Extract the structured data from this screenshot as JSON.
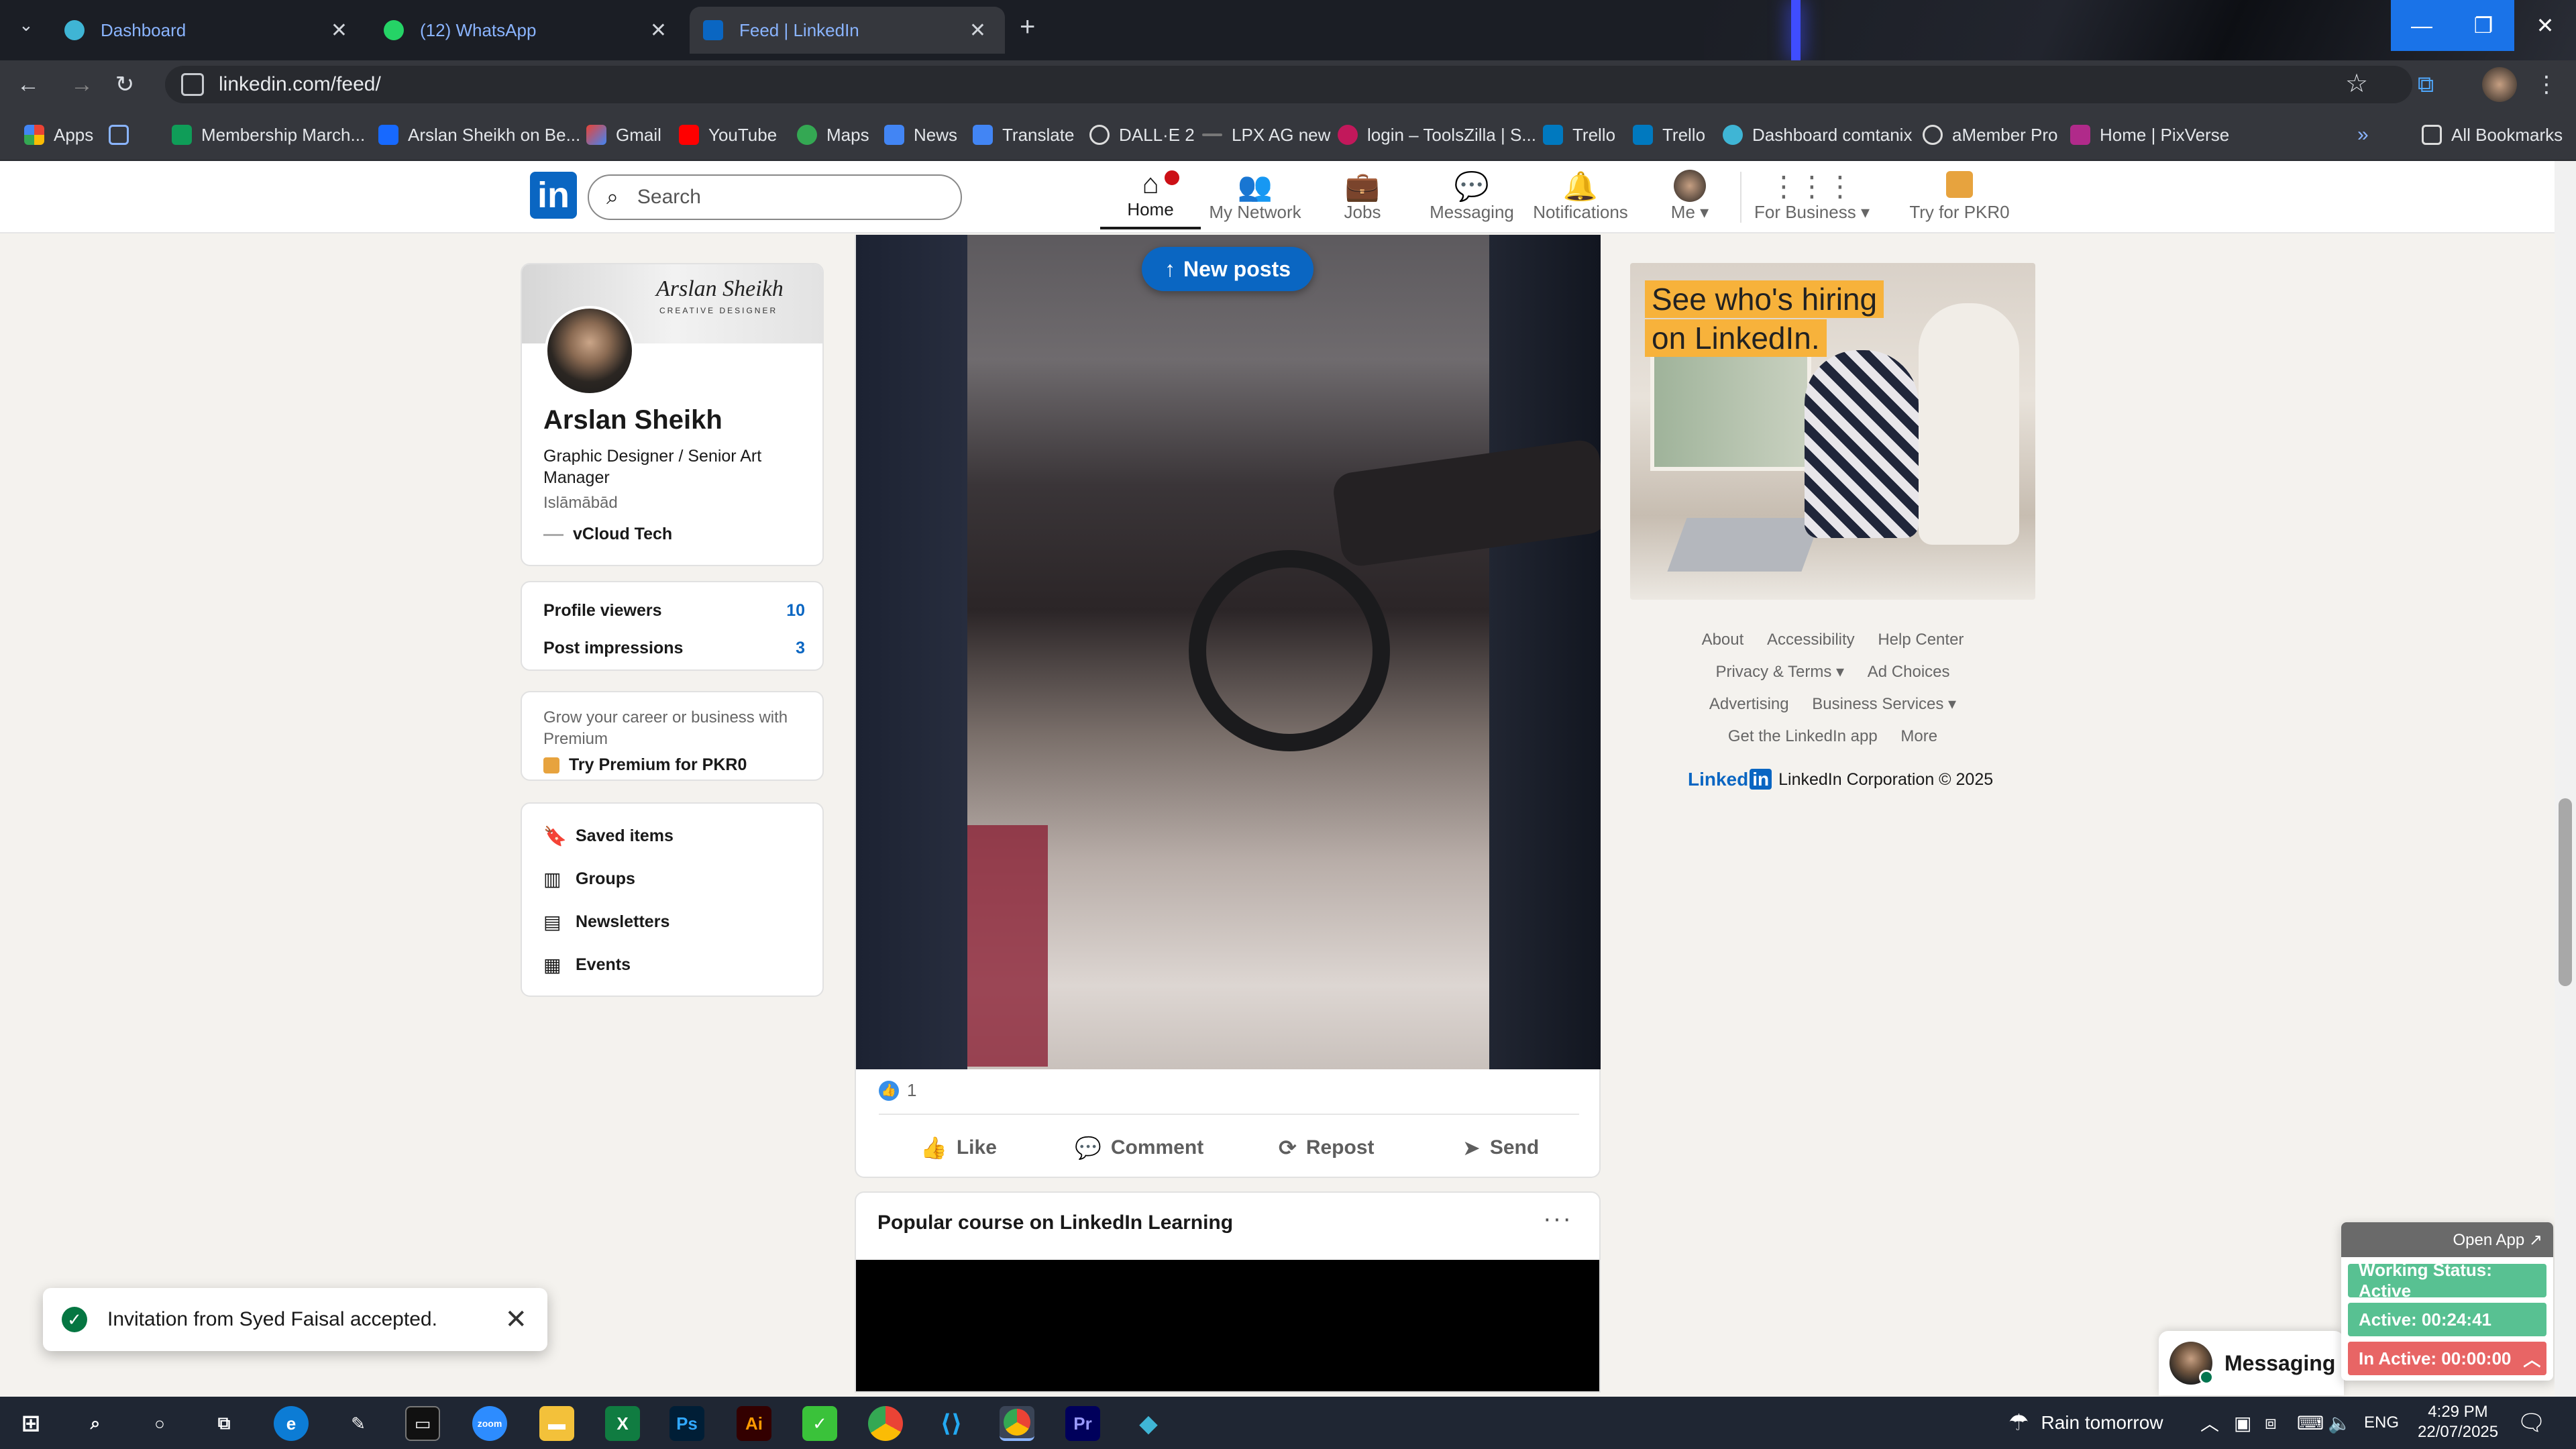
{
  "browser": {
    "tabs": [
      {
        "title": "Dashboard",
        "active": false
      },
      {
        "title": "(12) WhatsApp",
        "active": false
      },
      {
        "title": "Feed | LinkedIn",
        "active": true
      }
    ],
    "url": "linkedin.com/feed/",
    "bookmarks": [
      "Apps",
      "Membership March...",
      "Arslan Sheikh on Be...",
      "Gmail",
      "YouTube",
      "Maps",
      "News",
      "Translate",
      "DALL·E 2",
      "LPX AG new",
      "login – ToolsZilla | S...",
      "Trello",
      "Trello",
      "Dashboard comtanix",
      "aMember Pro",
      "Home | PixVerse"
    ],
    "all_bookmarks": "All Bookmarks"
  },
  "linkedin": {
    "search_placeholder": "Search",
    "nav": [
      {
        "label": "Home",
        "icon": "home-icon",
        "active": true
      },
      {
        "label": "My Network",
        "icon": "network-icon",
        "active": false
      },
      {
        "label": "Jobs",
        "icon": "briefcase-icon",
        "active": false
      },
      {
        "label": "Messaging",
        "icon": "chat-icon",
        "active": false
      },
      {
        "label": "Notifications",
        "icon": "bell-icon",
        "active": false
      },
      {
        "label": "Me",
        "icon": "avatar-icon",
        "active": false
      },
      {
        "label": "For Business",
        "icon": "grid-icon",
        "active": false
      },
      {
        "label": "Try for PKR0",
        "icon": "premium-icon",
        "active": false
      }
    ],
    "profile": {
      "banner_signature": "Arslan Sheikh",
      "banner_subtitle": "CREATIVE DESIGNER",
      "name": "Arslan Sheikh",
      "title": "Graphic Designer / Senior Art Manager",
      "location": "Islāmābād",
      "company": "vCloud Tech"
    },
    "stats": [
      {
        "label": "Profile viewers",
        "value": "10"
      },
      {
        "label": "Post impressions",
        "value": "3"
      }
    ],
    "premium": {
      "text": "Grow your career or business with Premium",
      "link": "Try Premium for PKR0"
    },
    "links": [
      {
        "label": "Saved items",
        "icon": "bookmark-icon"
      },
      {
        "label": "Groups",
        "icon": "groups-icon"
      },
      {
        "label": "Newsletters",
        "icon": "newsletter-icon"
      },
      {
        "label": "Events",
        "icon": "calendar-icon"
      }
    ],
    "new_posts": "New posts",
    "post": {
      "reaction_count": "1",
      "actions": [
        "Like",
        "Comment",
        "Repost",
        "Send"
      ]
    },
    "course_card_title": "Popular course on LinkedIn Learning",
    "ad": {
      "line1": "See who's hiring",
      "line2": "on LinkedIn."
    },
    "footer_links": [
      [
        "About",
        "Accessibility",
        "Help Center"
      ],
      [
        "Privacy & Terms ▾",
        "Ad Choices"
      ],
      [
        "Advertising",
        "Business Services ▾"
      ],
      [
        "Get the LinkedIn app",
        "More"
      ]
    ],
    "copyright": "LinkedIn Corporation © 2025",
    "messaging_label": "Messaging"
  },
  "toast": {
    "message": "Invitation from Syed Faisal accepted."
  },
  "tracker": {
    "open_app": "Open App ↗",
    "working_status": "Working Status: Active",
    "active": "Active: 00:24:41",
    "inactive": "In Active: 00:00:00"
  },
  "taskbar": {
    "weather": "Rain tomorrow",
    "lang": "ENG",
    "time": "4:29 PM",
    "date": "22/07/2025"
  }
}
